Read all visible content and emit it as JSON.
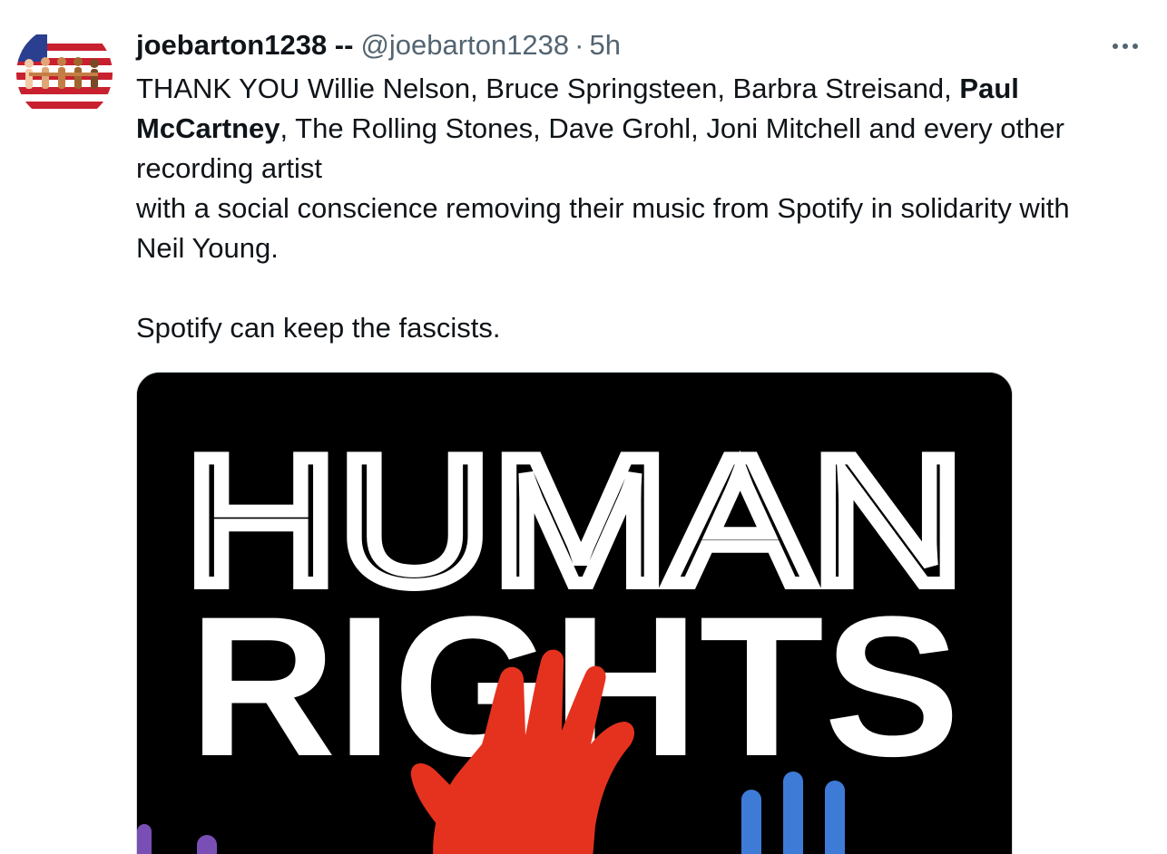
{
  "tweet": {
    "display_name": "joebarton1238 --",
    "handle": "@joebarton1238",
    "separator": "·",
    "time": "5h",
    "more_icon": "more-horizontal-icon",
    "text": {
      "line1_pre": "THANK YOU Willie Nelson, Bruce Springsteen, Barbra Streisand, ",
      "bold_name": "Paul McCartney",
      "line1_post": ", The Rolling Stones, Dave Grohl, Joni Mitchell  and every other recording artist",
      "line2": "with a social conscience removing their music from Spotify in solidarity with Neil Young.",
      "line3": "Spotify can keep the fascists."
    },
    "media": {
      "title_top": "HUMAN",
      "title_bottom": "RIGHTS"
    }
  },
  "colors": {
    "text": "#0f1419",
    "secondary": "#536471",
    "media_bg": "#000000",
    "hand_red": "#e5321f",
    "hand_blue": "#3e7bd6",
    "hand_purple": "#7a4fb5"
  }
}
